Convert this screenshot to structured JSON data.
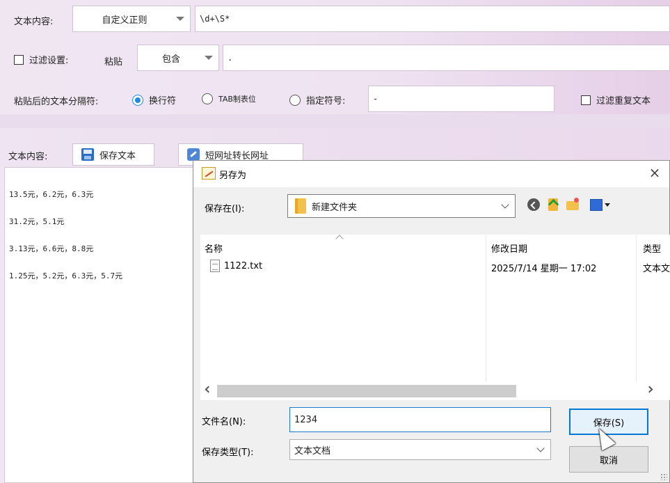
{
  "top": {
    "text_content_label": "文本内容:",
    "regex_mode": "自定义正则",
    "regex_value": "\\d+\\S*",
    "filter_label": "过滤设置:",
    "paste_label": "粘贴",
    "contain_mode": "包含",
    "filter_value": ".",
    "separator_label": "粘贴后的文本分隔符:",
    "radio_newline": "换行符",
    "radio_tab": "TAB制表位",
    "radio_custom": "指定符号:",
    "custom_symbol": "-",
    "dedupe_label": "过滤重复文本"
  },
  "lower": {
    "text_content_label": "文本内容:",
    "save_text_button": "保存文本",
    "short_url_button": "短网址转长网址",
    "result_lines": [
      "13.5元，6.2元，6.3元",
      "31.2元，5.1元",
      "3.13元，6.6元，8.8元",
      "1.25元，5.2元，6.3元，5.7元"
    ]
  },
  "dialog": {
    "title": "另存为",
    "close_glyph": "×",
    "save_in_label": "保存在(I):",
    "save_in_value": "新建文件夹",
    "columns": {
      "name": "名称",
      "modified": "修改日期",
      "type": "类型"
    },
    "files": [
      {
        "name": "1122.txt",
        "modified": "2025/7/14 星期一 17:02",
        "type": "文本文档"
      }
    ],
    "filename_label": "文件名(N):",
    "filename_value": "1234",
    "filetype_label": "保存类型(T):",
    "filetype_value": "文本文档",
    "save_button": "保存(S)",
    "cancel_button": "取消"
  }
}
